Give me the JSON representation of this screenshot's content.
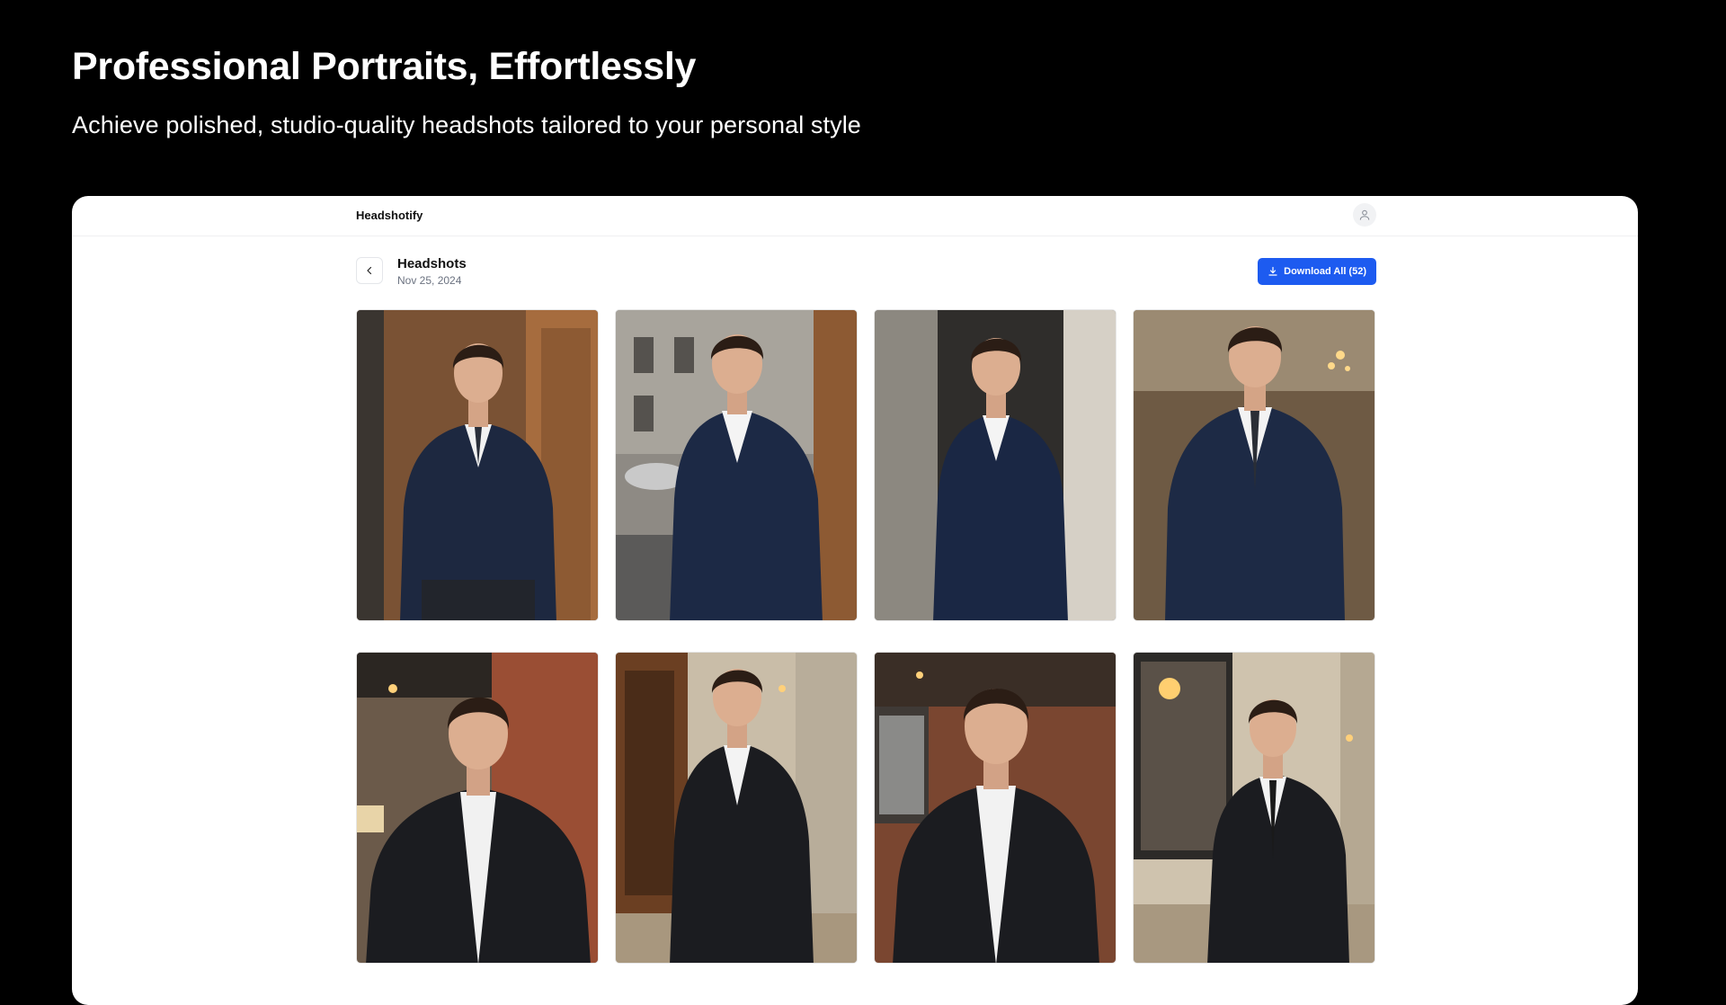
{
  "hero": {
    "title": "Professional Portraits, Effortlessly",
    "subtitle": "Achieve polished, studio-quality headshots tailored to your personal style"
  },
  "app": {
    "brand": "Headshotify",
    "page": {
      "title": "Headshots",
      "date": "Nov 25, 2024",
      "download_label": "Download All (52)"
    },
    "icons": {
      "back": "chevron-left-icon",
      "download": "download-icon",
      "avatar": "user-icon"
    },
    "accent": "#1d5bf0"
  }
}
